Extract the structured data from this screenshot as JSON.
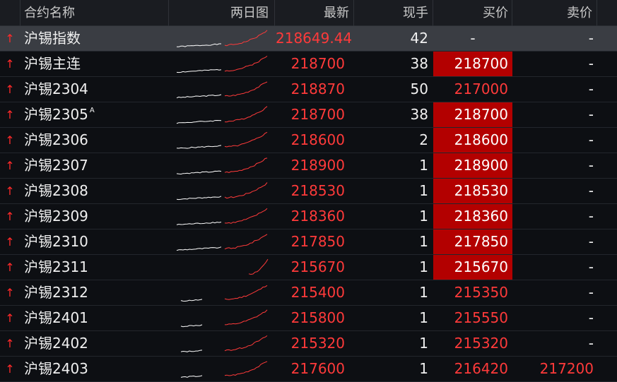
{
  "header": {
    "name": "合约名称",
    "sparkline": "两日图",
    "last": "最新",
    "volume": "现手",
    "bid": "买价",
    "ask": "卖价"
  },
  "colors": {
    "up": "#ff3a3a",
    "bid_highlight": "#b30000",
    "spark_prev": "#ffffff",
    "spark_today": "#ff3a3a"
  },
  "rows": [
    {
      "arrow": "↑",
      "name": "沪锡指数",
      "sup": "",
      "last": "218649.44",
      "volume": "42",
      "bid": "-",
      "bid_hl": false,
      "ask": "-",
      "selected": true
    },
    {
      "arrow": "↑",
      "name": "沪锡主连",
      "sup": "",
      "last": "218700",
      "volume": "38",
      "bid": "218700",
      "bid_hl": true,
      "ask": "-",
      "selected": false
    },
    {
      "arrow": "↑",
      "name": "沪锡2304",
      "sup": "",
      "last": "218870",
      "volume": "50",
      "bid": "217000",
      "bid_hl": false,
      "ask": "-",
      "selected": false
    },
    {
      "arrow": "↑",
      "name": "沪锡2305",
      "sup": "A",
      "last": "218700",
      "volume": "38",
      "bid": "218700",
      "bid_hl": true,
      "ask": "-",
      "selected": false
    },
    {
      "arrow": "↑",
      "name": "沪锡2306",
      "sup": "",
      "last": "218600",
      "volume": "2",
      "bid": "218600",
      "bid_hl": true,
      "ask": "-",
      "selected": false
    },
    {
      "arrow": "↑",
      "name": "沪锡2307",
      "sup": "",
      "last": "218900",
      "volume": "1",
      "bid": "218900",
      "bid_hl": true,
      "ask": "-",
      "selected": false
    },
    {
      "arrow": "↑",
      "name": "沪锡2308",
      "sup": "",
      "last": "218530",
      "volume": "1",
      "bid": "218530",
      "bid_hl": true,
      "ask": "-",
      "selected": false
    },
    {
      "arrow": "↑",
      "name": "沪锡2309",
      "sup": "",
      "last": "218360",
      "volume": "1",
      "bid": "218360",
      "bid_hl": true,
      "ask": "-",
      "selected": false
    },
    {
      "arrow": "↑",
      "name": "沪锡2310",
      "sup": "",
      "last": "217850",
      "volume": "1",
      "bid": "217850",
      "bid_hl": true,
      "ask": "-",
      "selected": false
    },
    {
      "arrow": "↑",
      "name": "沪锡2311",
      "sup": "",
      "last": "215670",
      "volume": "1",
      "bid": "215670",
      "bid_hl": true,
      "ask": "-",
      "selected": false
    },
    {
      "arrow": "↑",
      "name": "沪锡2312",
      "sup": "",
      "last": "215400",
      "volume": "1",
      "bid": "215350",
      "bid_hl": false,
      "ask": "-",
      "selected": false
    },
    {
      "arrow": "↑",
      "name": "沪锡2401",
      "sup": "",
      "last": "215800",
      "volume": "1",
      "bid": "215550",
      "bid_hl": false,
      "ask": "-",
      "selected": false
    },
    {
      "arrow": "↑",
      "name": "沪锡2402",
      "sup": "",
      "last": "215320",
      "volume": "1",
      "bid": "215320",
      "bid_hl": false,
      "ask": "-",
      "selected": false
    },
    {
      "arrow": "↑",
      "name": "沪锡2403",
      "sup": "",
      "last": "217600",
      "volume": "1",
      "bid": "216420",
      "bid_hl": false,
      "ask": "217200",
      "selected": false
    }
  ]
}
